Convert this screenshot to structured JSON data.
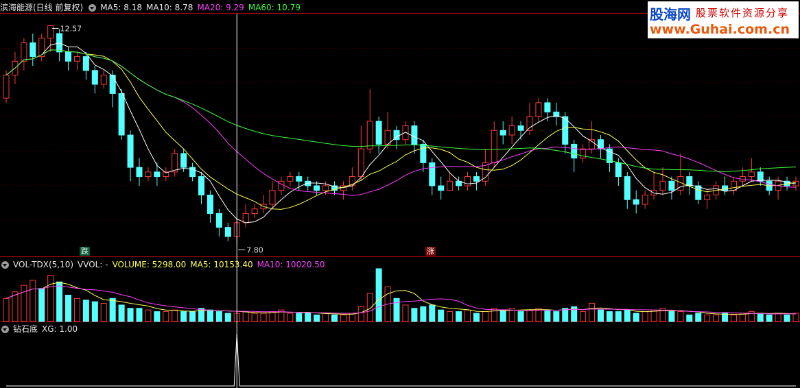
{
  "header": {
    "stock_title": "滨海能源(日线 前复权)",
    "ma5": "MA5: 8.18",
    "ma10": "MA10: 8.78",
    "ma20": "MA20: 9.29",
    "ma60": "MA60: 10.79"
  },
  "volume_header": {
    "indicator": "VOL-TDX(5,10)",
    "vvol": "VVOL: -",
    "volume": "VOLUME: 5298.00",
    "ma5": "MA5: 10153.40",
    "ma10": "MA10: 10020.50"
  },
  "signal_header": {
    "indicator": "钻石底",
    "xg": "XG: 1.00"
  },
  "markers": {
    "high_label": "12.57",
    "low_label": "7.80",
    "badge_fall": "跌",
    "badge_rise": "涨"
  },
  "watermark": {
    "brand": "股海网",
    "slogan": "股票软件资源分享",
    "url": "www.Guhai.com.cn"
  },
  "colors": {
    "up": "#ff3a3a",
    "down": "#54ffff",
    "ma5": "#ffffff",
    "ma10": "#ffff54",
    "ma20": "#ff40ff",
    "ma60": "#3cff3c",
    "frame": "#b00000",
    "crosshair": "#ffffff"
  },
  "chart_data": [
    {
      "type": "candlestick",
      "title": "滨海能源(日线 前复权)",
      "xlabel": "",
      "ylabel": "",
      "ylim": [
        7.6,
        12.8
      ],
      "annotations": [
        {
          "text": "12.57",
          "kind": "period-high"
        },
        {
          "text": "7.80",
          "kind": "period-low"
        },
        {
          "text": "跌"
        },
        {
          "text": "涨"
        }
      ],
      "candles": [
        [
          11.0,
          11.5,
          11.6,
          10.9
        ],
        [
          11.5,
          11.8,
          12.0,
          11.3
        ],
        [
          11.8,
          12.2,
          12.3,
          11.6
        ],
        [
          12.2,
          11.9,
          12.4,
          11.7
        ],
        [
          11.9,
          12.3,
          12.4,
          11.8
        ],
        [
          12.3,
          12.57,
          12.57,
          12.0
        ],
        [
          12.4,
          12.0,
          12.5,
          11.8
        ],
        [
          12.0,
          11.8,
          12.1,
          11.6
        ],
        [
          11.8,
          11.9,
          12.0,
          11.6
        ],
        [
          11.9,
          11.6,
          12.0,
          11.4
        ],
        [
          11.6,
          11.3,
          11.7,
          11.1
        ],
        [
          11.3,
          11.5,
          11.6,
          11.2
        ],
        [
          11.5,
          11.1,
          11.6,
          10.8
        ],
        [
          11.1,
          10.2,
          11.2,
          10.1
        ],
        [
          10.2,
          9.5,
          10.3,
          9.2
        ],
        [
          9.5,
          9.3,
          9.7,
          9.1
        ],
        [
          9.3,
          9.4,
          9.5,
          9.2
        ],
        [
          9.4,
          9.3,
          9.6,
          9.1
        ],
        [
          9.3,
          9.4,
          9.5,
          9.2
        ],
        [
          9.4,
          9.8,
          9.9,
          9.3
        ],
        [
          9.8,
          9.5,
          9.9,
          9.4
        ],
        [
          9.5,
          9.3,
          9.6,
          9.2
        ],
        [
          9.3,
          8.9,
          9.4,
          8.7
        ],
        [
          8.9,
          8.5,
          9.0,
          8.3
        ],
        [
          8.5,
          8.2,
          8.6,
          8.0
        ],
        [
          8.2,
          8.0,
          8.3,
          7.9
        ],
        [
          8.0,
          8.3,
          8.4,
          7.8
        ],
        [
          8.3,
          8.5,
          8.7,
          8.2
        ],
        [
          8.5,
          8.6,
          8.7,
          8.4
        ],
        [
          8.6,
          8.7,
          8.9,
          8.5
        ],
        [
          8.7,
          9.0,
          9.2,
          8.6
        ],
        [
          9.0,
          9.2,
          9.3,
          8.9
        ],
        [
          9.2,
          9.3,
          9.4,
          9.1
        ],
        [
          9.3,
          9.2,
          9.4,
          9.0
        ],
        [
          9.2,
          9.1,
          9.3,
          9.0
        ],
        [
          9.1,
          9.0,
          9.2,
          8.9
        ],
        [
          9.0,
          9.1,
          9.2,
          8.9
        ],
        [
          9.1,
          9.0,
          9.2,
          8.9
        ],
        [
          9.0,
          9.1,
          9.2,
          8.8
        ],
        [
          9.1,
          9.3,
          9.5,
          9.0
        ],
        [
          9.3,
          9.9,
          10.4,
          9.2
        ],
        [
          9.9,
          10.5,
          11.2,
          9.8
        ],
        [
          10.5,
          10.0,
          10.6,
          9.8
        ],
        [
          10.0,
          10.3,
          10.7,
          9.9
        ],
        [
          10.3,
          10.1,
          10.4,
          9.9
        ],
        [
          10.1,
          10.4,
          10.5,
          10.0
        ],
        [
          10.4,
          10.0,
          10.5,
          9.8
        ],
        [
          10.0,
          9.6,
          10.1,
          9.4
        ],
        [
          9.6,
          9.1,
          9.7,
          8.9
        ],
        [
          9.1,
          9.0,
          9.3,
          8.8
        ],
        [
          9.0,
          9.2,
          9.4,
          9.0
        ],
        [
          9.2,
          9.1,
          9.3,
          9.0
        ],
        [
          9.1,
          9.3,
          9.4,
          9.0
        ],
        [
          9.3,
          9.2,
          9.4,
          9.0
        ],
        [
          9.2,
          9.6,
          9.9,
          9.1
        ],
        [
          9.6,
          10.3,
          10.5,
          9.5
        ],
        [
          10.3,
          10.2,
          10.5,
          10.0
        ],
        [
          10.2,
          10.4,
          10.6,
          10.0
        ],
        [
          10.4,
          10.3,
          10.5,
          10.1
        ],
        [
          10.3,
          10.6,
          10.9,
          10.2
        ],
        [
          10.6,
          10.9,
          11.0,
          10.5
        ],
        [
          10.9,
          10.7,
          11.0,
          10.5
        ],
        [
          10.7,
          10.6,
          10.9,
          10.4
        ],
        [
          10.6,
          10.0,
          10.7,
          9.8
        ],
        [
          10.0,
          9.7,
          10.1,
          9.4
        ],
        [
          9.7,
          9.9,
          10.0,
          9.6
        ],
        [
          9.9,
          10.1,
          10.5,
          9.8
        ],
        [
          10.1,
          9.9,
          10.2,
          9.7
        ],
        [
          9.9,
          9.6,
          10.0,
          9.4
        ],
        [
          9.6,
          9.3,
          9.7,
          9.1
        ],
        [
          9.3,
          8.8,
          9.4,
          8.6
        ],
        [
          8.8,
          8.7,
          9.0,
          8.5
        ],
        [
          8.7,
          8.9,
          9.0,
          8.6
        ],
        [
          8.9,
          9.0,
          9.4,
          8.8
        ],
        [
          9.0,
          9.2,
          9.5,
          8.9
        ],
        [
          9.2,
          9.0,
          9.3,
          8.8
        ],
        [
          9.0,
          9.3,
          9.8,
          8.9
        ],
        [
          9.3,
          9.1,
          9.4,
          8.9
        ],
        [
          9.1,
          8.8,
          9.2,
          8.7
        ],
        [
          8.8,
          8.9,
          9.0,
          8.6
        ],
        [
          8.9,
          9.1,
          9.2,
          8.8
        ],
        [
          9.1,
          9.0,
          9.3,
          8.9
        ],
        [
          9.0,
          9.2,
          9.3,
          8.9
        ],
        [
          9.2,
          9.3,
          9.5,
          9.1
        ],
        [
          9.3,
          9.4,
          9.7,
          9.2
        ],
        [
          9.4,
          9.2,
          9.5,
          9.1
        ],
        [
          9.2,
          9.0,
          9.3,
          8.9
        ],
        [
          9.0,
          9.2,
          9.3,
          8.8
        ],
        [
          9.2,
          9.1,
          9.3,
          9.0
        ],
        [
          9.1,
          9.2,
          9.3,
          9.0
        ]
      ],
      "ma_series": [
        {
          "name": "MA5",
          "last": 8.18
        },
        {
          "name": "MA10",
          "last": 8.78
        },
        {
          "name": "MA20",
          "last": 9.29
        },
        {
          "name": "MA60",
          "last": 10.79
        }
      ]
    },
    {
      "type": "bar",
      "title": "VOL-TDX(5,10)",
      "volumes": [
        14,
        18,
        22,
        25,
        20,
        28,
        24,
        16,
        14,
        13,
        12,
        11,
        14,
        10,
        8,
        8,
        7,
        6,
        6,
        7,
        6,
        6,
        8,
        7,
        6,
        5,
        5,
        6,
        5,
        5,
        6,
        7,
        5,
        5,
        5,
        4,
        5,
        4,
        4,
        5,
        9,
        17,
        32,
        21,
        14,
        10,
        8,
        9,
        10,
        7,
        6,
        6,
        7,
        5,
        6,
        8,
        7,
        8,
        6,
        7,
        8,
        7,
        6,
        8,
        9,
        6,
        11,
        7,
        6,
        6,
        7,
        5,
        6,
        7,
        8,
        6,
        6,
        4,
        5,
        4,
        4,
        5,
        4,
        5,
        6,
        5,
        4,
        5,
        4,
        5
      ],
      "up_down": [
        1,
        1,
        1,
        1,
        0,
        1,
        0,
        0,
        1,
        0,
        0,
        1,
        0,
        0,
        0,
        0,
        1,
        0,
        1,
        1,
        0,
        0,
        0,
        0,
        0,
        0,
        1,
        1,
        1,
        1,
        1,
        1,
        1,
        0,
        0,
        0,
        1,
        0,
        1,
        1,
        1,
        1,
        0,
        1,
        0,
        1,
        0,
        0,
        0,
        0,
        1,
        0,
        1,
        0,
        1,
        1,
        0,
        1,
        0,
        1,
        1,
        0,
        0,
        0,
        0,
        1,
        1,
        0,
        0,
        0,
        0,
        0,
        1,
        1,
        1,
        0,
        1,
        0,
        0,
        1,
        1,
        0,
        1,
        1,
        1,
        0,
        0,
        1,
        0,
        1
      ],
      "last_volume": 5298.0,
      "ma5": 10153.4,
      "ma10": 10020.5
    },
    {
      "type": "line",
      "title": "钻石底",
      "signal_index": 26,
      "xg": 1.0
    }
  ]
}
